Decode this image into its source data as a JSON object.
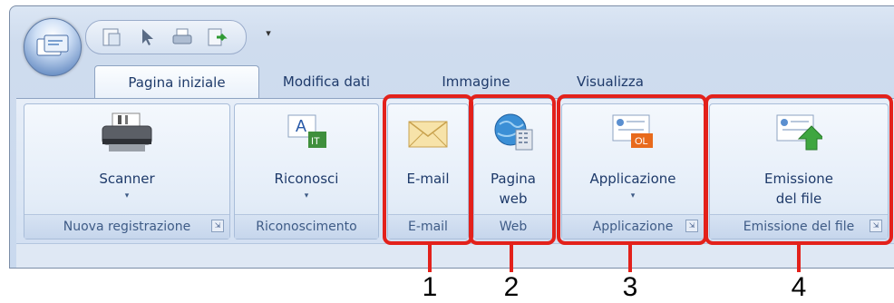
{
  "tabs": [
    {
      "label": "Pagina iniziale",
      "active": true
    },
    {
      "label": "Modifica dati",
      "active": false
    },
    {
      "label": "Immagine",
      "active": false
    },
    {
      "label": "Visualizza",
      "active": false
    }
  ],
  "groups": {
    "nuova_registrazione": {
      "label": "Nuova registrazione",
      "button": "Scanner"
    },
    "riconoscimento": {
      "label": "Riconoscimento",
      "button": "Riconosci"
    },
    "email": {
      "label": "E-mail",
      "button": "E-mail"
    },
    "web": {
      "label": "Web",
      "button_line1": "Pagina",
      "button_line2": "web"
    },
    "applicazione": {
      "label": "Applicazione",
      "button": "Applicazione"
    },
    "emissione": {
      "label": "Emissione del file",
      "button_line1": "Emissione",
      "button_line2": "del file"
    }
  },
  "callouts": [
    "1",
    "2",
    "3",
    "4"
  ],
  "icons": {
    "orb": "scanner-app-orb-icon",
    "qat": [
      "save-icon",
      "pointer-icon",
      "print-icon",
      "export-icon"
    ],
    "qat_customize": "▾",
    "caret": "▾",
    "launcher": "⇲"
  },
  "colors": {
    "highlight": "#e3211b",
    "text": "#1e3a6a",
    "group_label": "#3e5b86"
  }
}
